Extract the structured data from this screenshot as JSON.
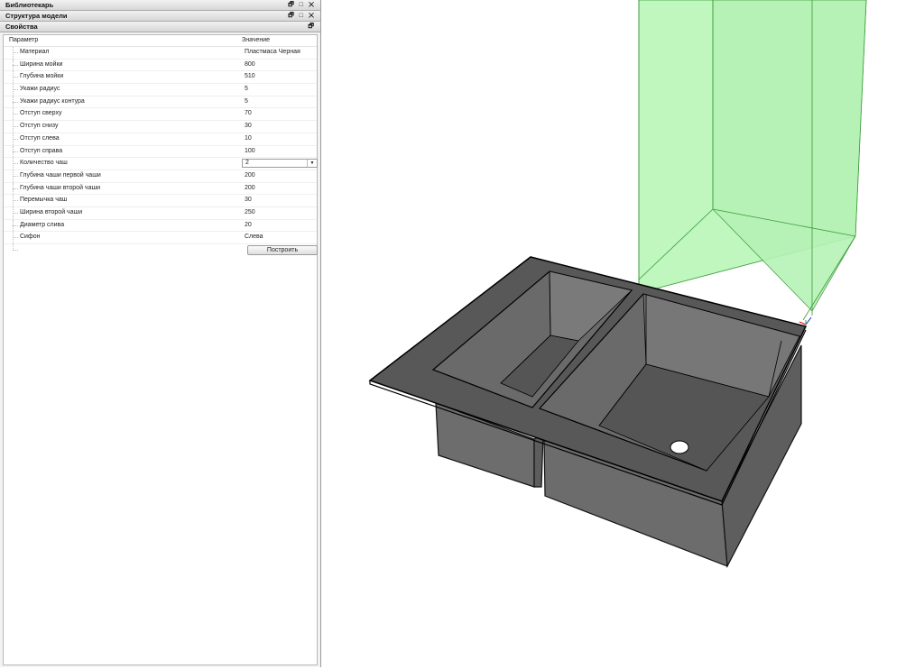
{
  "panels": {
    "librarian": {
      "title": "Библиотекарь",
      "buttons": "🗗 □ ✕"
    },
    "model_structure": {
      "title": "Структура модели",
      "buttons": "🗗 □ ✕"
    },
    "properties": {
      "title": "Свойства",
      "buttons": "🗗"
    }
  },
  "table": {
    "col_param": "Параметр",
    "col_value": "Значение",
    "rows": [
      {
        "name": "Материал",
        "value": "Пластмаса Черная"
      },
      {
        "name": "Ширина мойки",
        "value": "800"
      },
      {
        "name": "Глубина мойки",
        "value": "510"
      },
      {
        "name": "Укажи радиус",
        "value": "5"
      },
      {
        "name": "Укажи радиус контура",
        "value": "5"
      },
      {
        "name": "Отступ сверху",
        "value": "70"
      },
      {
        "name": "Отступ снизу",
        "value": "30"
      },
      {
        "name": "Отступ слева",
        "value": "10"
      },
      {
        "name": "Отступ справа",
        "value": "100"
      },
      {
        "name": "Количество чаш",
        "value": "2"
      },
      {
        "name": "Глубина чаши первой чаши",
        "value": "200"
      },
      {
        "name": "Глубина чаши второй чаши",
        "value": "200"
      },
      {
        "name": "Перемычка чаш",
        "value": "30"
      },
      {
        "name": "Ширина второй чаши",
        "value": "250"
      },
      {
        "name": "Диаметр слива",
        "value": "20"
      },
      {
        "name": "Сифон",
        "value": "Слева"
      }
    ],
    "build_label": "Построить"
  },
  "colors": {
    "sink_top": "#5a5a5a",
    "sink_side": "#6b6b6b",
    "bounding_box": "#bff5bf"
  }
}
